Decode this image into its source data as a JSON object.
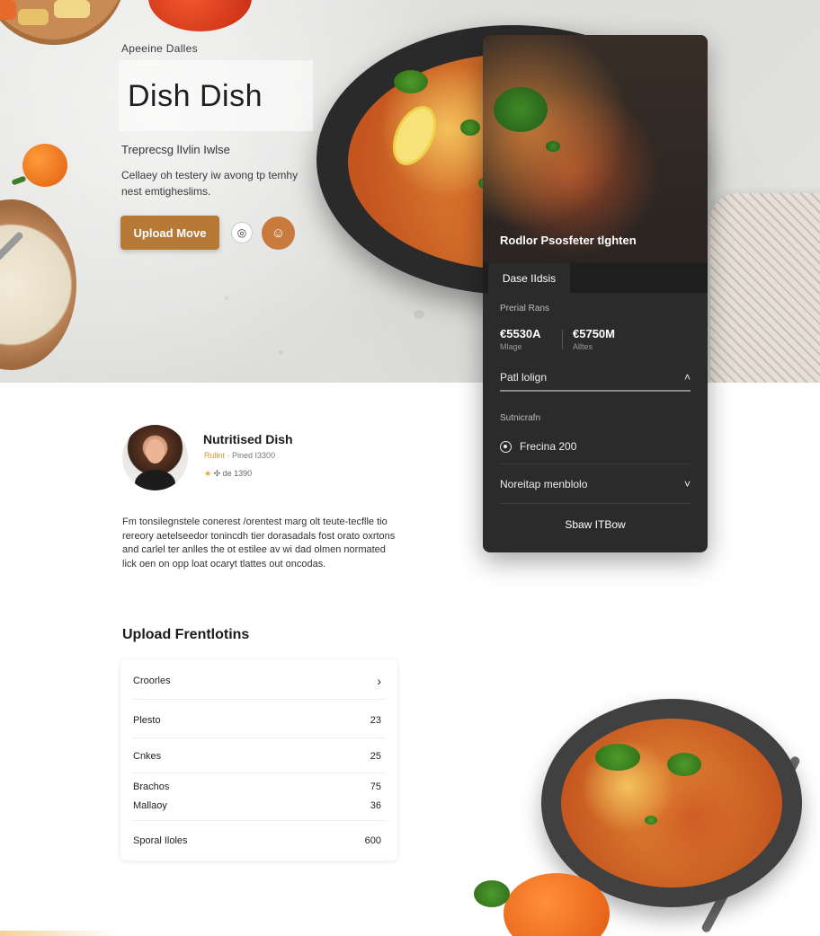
{
  "hero": {
    "eyebrow": "Apeeine Dalles",
    "title": "Dish Dish",
    "subhead": "Treprecsg lIvlin Iwlse",
    "description": "Cellaey oh testery iw avong tp temhy nest emtigheslims.",
    "upload_button": "Upload Move",
    "circle_light_icon": "compass-icon",
    "circle_orange_icon": "user-icon"
  },
  "panel": {
    "overlay_caption": "Rodlor Psosfeter tlghten",
    "tab_label": "Dase IIdsis",
    "section_label": "Prerial Rans",
    "stats": [
      {
        "value": "€5530A",
        "sub": "Mlage"
      },
      {
        "value": "€5750M",
        "sub": "Alltes"
      }
    ],
    "path_row": "Patl lolign",
    "path_chevron": "˄",
    "sub_label": "Sutnicrafn",
    "protein_row": "Frecina 200",
    "nutrition_row": "Noreitap menblolo",
    "nutrition_chevron": "˅",
    "show_button": "Sbaw ITBow"
  },
  "profile": {
    "name": "Nutritised Dish",
    "meta_highlight": "Rullnt",
    "meta_rest": "· Pined I3300",
    "rating": "de 1390",
    "bio": "Fm tonsilegnstele conerest /orentest marg olt teute-tecflle tio rereory aetelseedor tonincdh tier dorasadals fost orato oxrtons and carlel ter anlles the ot estilee av wi dad olmen normated lick oen on opp loat ocaryt tlattes out oncodas."
  },
  "upload": {
    "title": "Upload Frentlotins",
    "rows": [
      {
        "label": "Croorles",
        "value": "›"
      },
      {
        "label": "Plesto",
        "value": "23"
      },
      {
        "label": "Cnkes",
        "value": "25"
      },
      {
        "label": "Brachos",
        "value": "75"
      },
      {
        "label": "Mallaoy",
        "value": "36"
      },
      {
        "label": "Sporal Iloles",
        "value": "600"
      }
    ]
  },
  "colors": {
    "accent": "#b77a36",
    "panel_bg": "#2b2b2b",
    "hero_bg": "#e2e2e0"
  }
}
